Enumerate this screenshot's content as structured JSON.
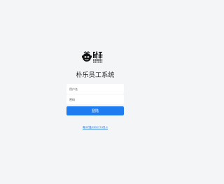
{
  "brand": {
    "logo_text_cn": "朴乐",
    "logo_text_en": "POLEX STORE"
  },
  "title": "朴乐员工系统",
  "form": {
    "username_placeholder": "用户名",
    "password_placeholder": "密码",
    "login_label": "登陆"
  },
  "footer": {
    "icp_text": "粤ICP备2302774号-1"
  },
  "colors": {
    "background": "#f4f5f7",
    "primary": "#1f7bf0",
    "link": "#2a73d8"
  }
}
